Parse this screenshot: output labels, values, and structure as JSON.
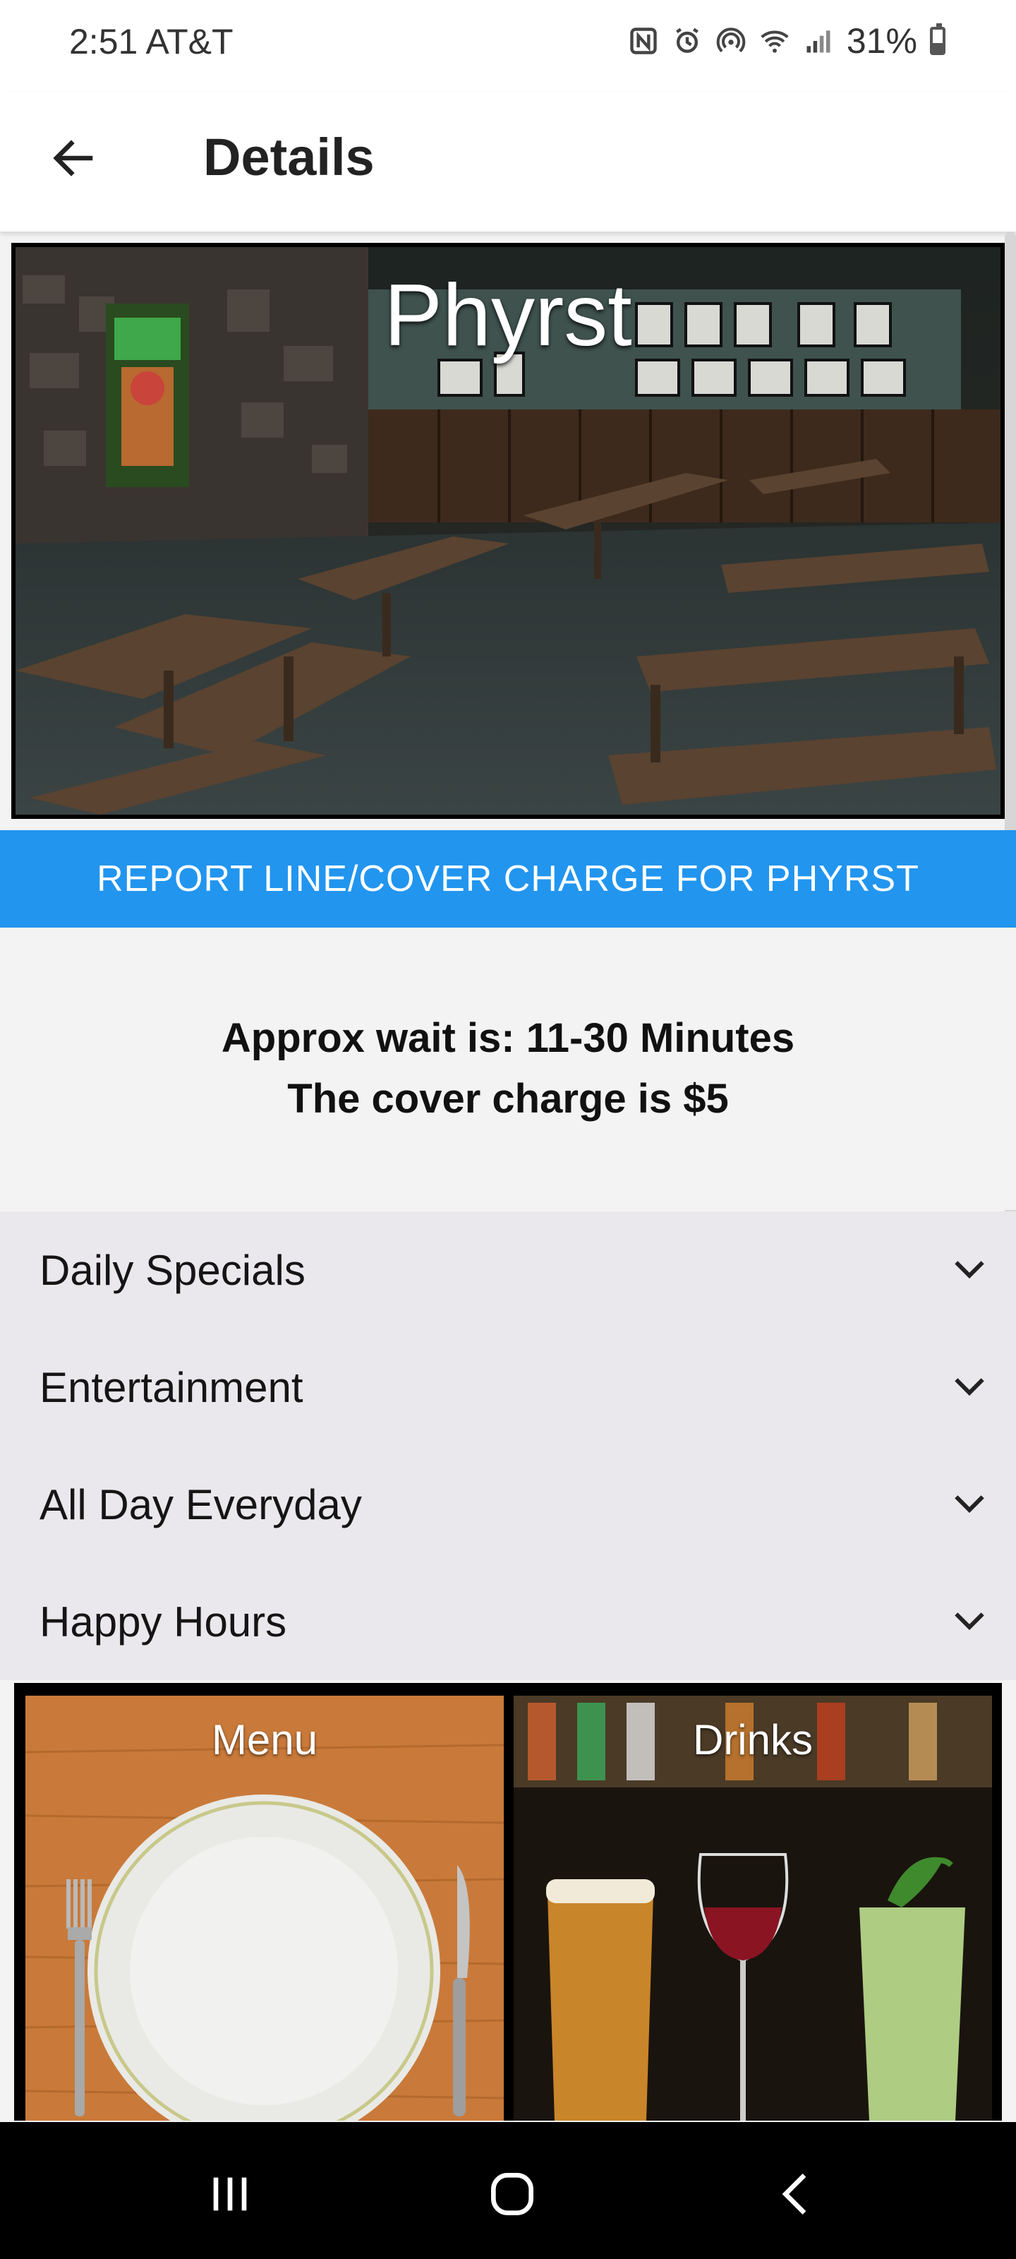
{
  "status_bar": {
    "time": "2:51 AT&T",
    "battery": "31%",
    "battery_level": 0.31,
    "icons": [
      "nfc-icon",
      "alarm-icon",
      "hotspot-icon",
      "wifi-icon",
      "signal-icon",
      "battery-icon"
    ]
  },
  "app_bar": {
    "title": "Details",
    "back_icon": "arrow-left-icon"
  },
  "venue": {
    "name": "Phyrst"
  },
  "report_button": {
    "label": "REPORT LINE/COVER CHARGE FOR PHYRST",
    "color": "#2295ef"
  },
  "wait_info": {
    "wait_text": "Approx wait is: 11-30 Minutes",
    "cover_text": "The cover charge is $5"
  },
  "accordion": [
    {
      "label": "Daily Specials",
      "icon": "chevron-down-icon"
    },
    {
      "label": "Entertainment",
      "icon": "chevron-down-icon"
    },
    {
      "label": "All Day Everyday",
      "icon": "chevron-down-icon"
    },
    {
      "label": "Happy Hours",
      "icon": "chevron-down-icon"
    }
  ],
  "tiles": [
    {
      "label": "Menu"
    },
    {
      "label": "Drinks"
    }
  ],
  "nav_bar": {
    "icons": [
      "recent-apps-icon",
      "home-icon",
      "back-icon"
    ]
  }
}
